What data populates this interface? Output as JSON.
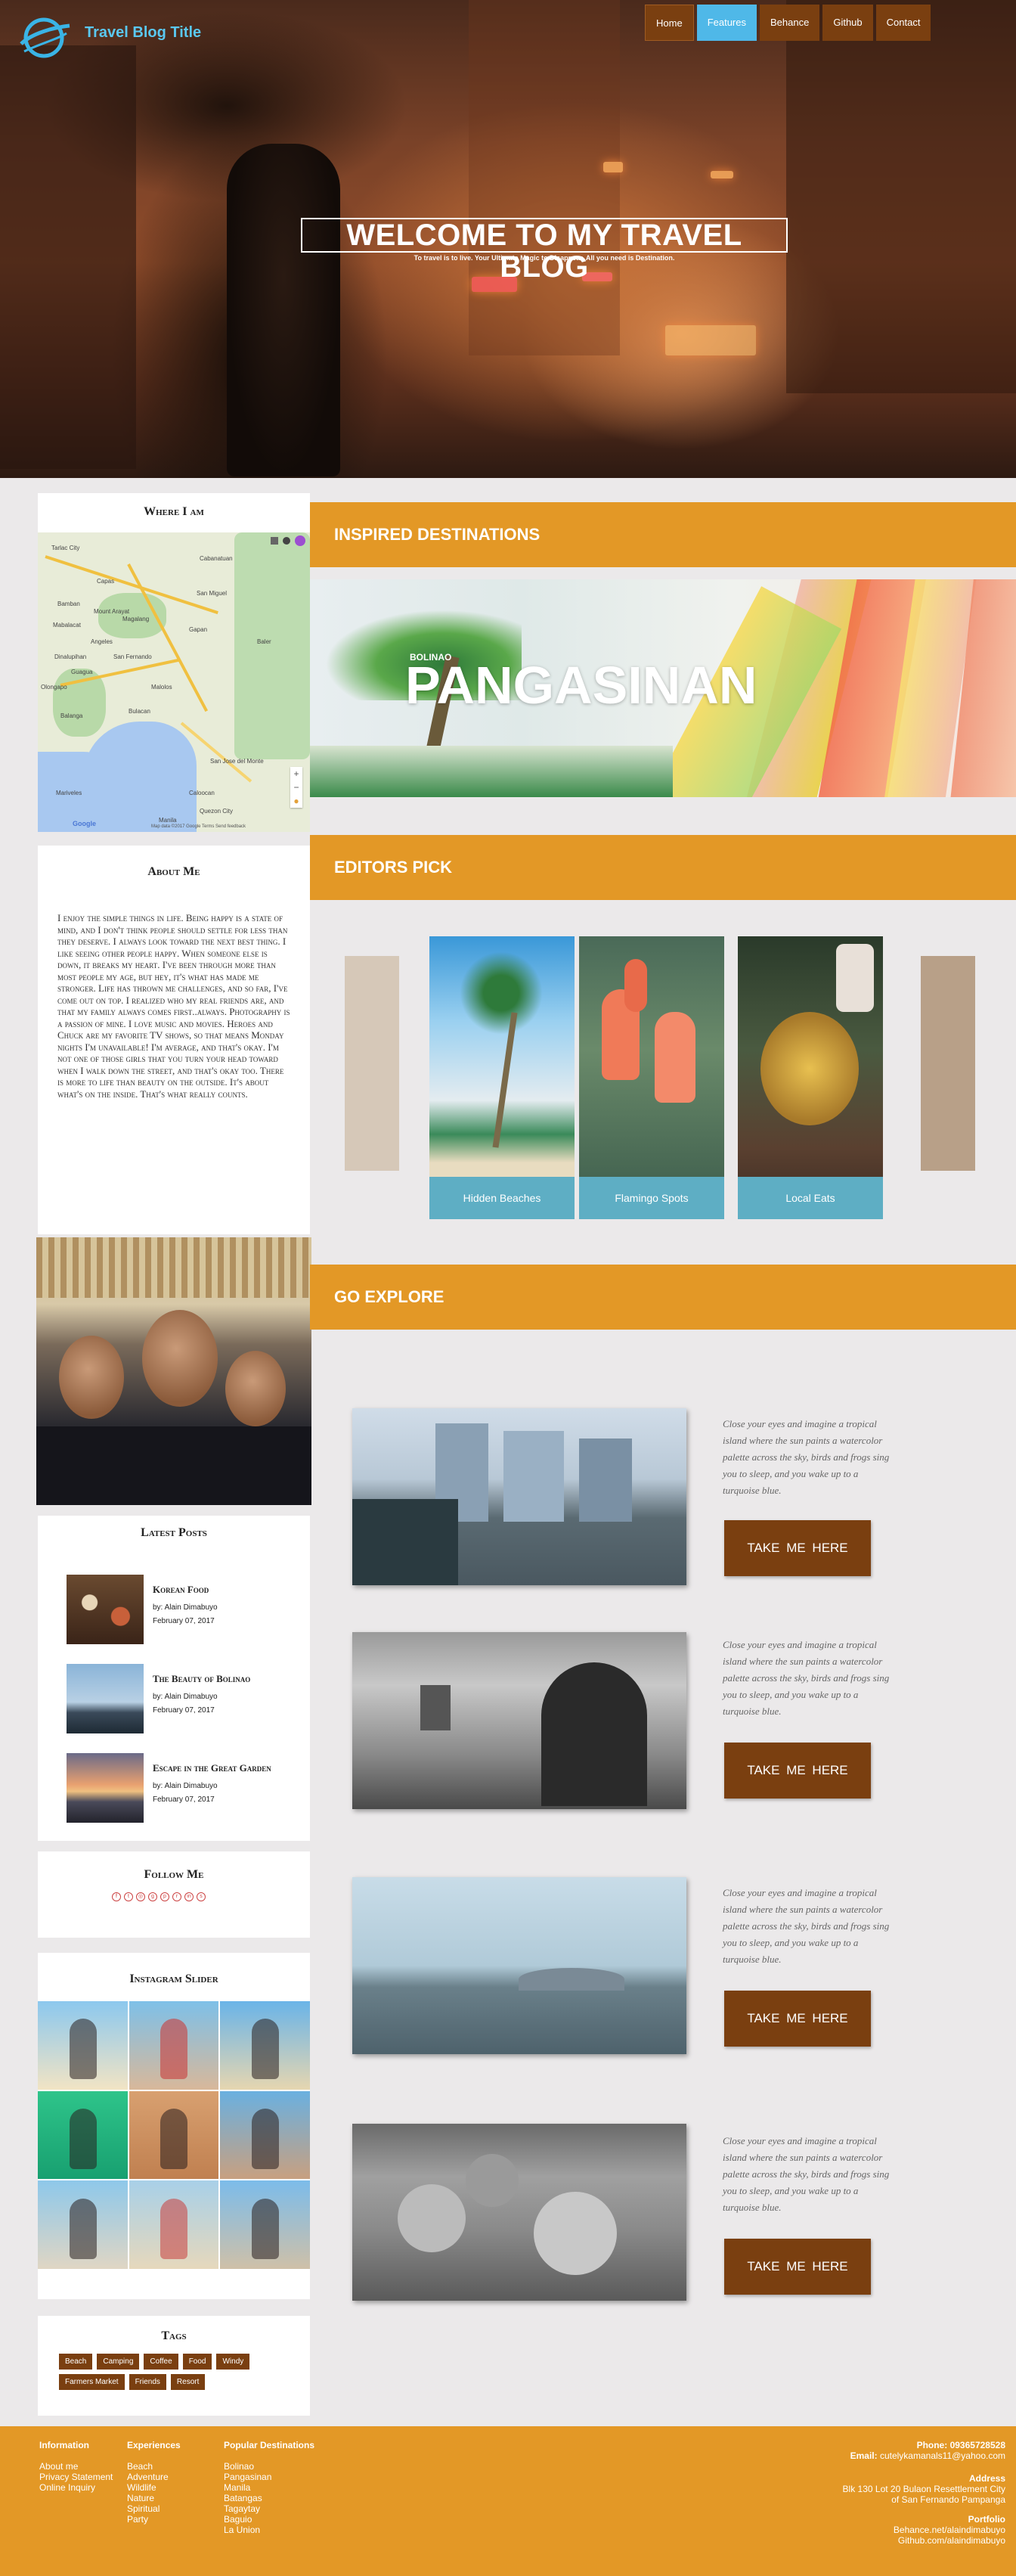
{
  "header": {
    "brand": "Travel Blog Title",
    "nav": [
      "Home",
      "Features",
      "Behance",
      "Github",
      "Contact"
    ],
    "active_nav": "Features"
  },
  "hero": {
    "title": "WELCOME TO MY TRAVEL BLOG",
    "subtitle": "To travel is to live. Your Ultimate Magic to Disappear. All you need is Destination."
  },
  "sidebar": {
    "where": {
      "title": "Where I am",
      "map_towns": [
        "Tarlac City",
        "Capas",
        "Bamban",
        "Magalang",
        "Mabalacat",
        "Angeles",
        "San Fernando",
        "Guagua",
        "Olongapo",
        "Dinalupihan",
        "Balanga",
        "Malolos",
        "Bulacan",
        "San Miguel",
        "Cabanatuan",
        "Gapan",
        "Mariveles",
        "Quezon City",
        "Manila",
        "San Jose del Monte",
        "Caloocan",
        "Mount Arayat",
        "Baler"
      ],
      "map_credit": "Map data ©2017 Google  Terms  Send feedback",
      "google_logo": "Google"
    },
    "about": {
      "title": "About Me",
      "text": "I enjoy the simple things in life. Being happy is a state of mind, and I don't think people should settle for less than they deserve. I always look toward the next best thing. I like seeing other people happy. When someone else is down, it breaks my heart. I've been through more than most people my age, but hey, it's what has made me stronger. Life has thrown me challenges, and so far, I've come out on top. I realized who my real friends are, and that my family always comes first..always. Photography is a passion of mine. I love music and movies. Heroes and Chuck are my favorite TV shows, so that means Monday nights I'm unavailable! I'm average, and that's okay. I'm not one of those girls that you turn your head toward when I walk down the street, and that's okay too. There is more to life than beauty on the outside. It's about what's on the inside. That's what really counts."
    },
    "latest": {
      "title": "Latest Posts",
      "posts": [
        {
          "title": "Korean Food",
          "author": "by: Alain Dimabuyo",
          "date": "February 07, 2017"
        },
        {
          "title": "The Beauty of Bolinao",
          "author": "by: Alain Dimabuyo",
          "date": "February 07, 2017"
        },
        {
          "title": "Escape in the Great Garden",
          "author": "by: Alain Dimabuyo",
          "date": "February 07, 2017"
        }
      ]
    },
    "follow": {
      "title": "Follow Me",
      "icons": [
        "facebook-icon",
        "twitter-icon",
        "instagram-icon",
        "google-plus-icon",
        "pinterest-icon",
        "rss-icon",
        "linkedin-icon",
        "skype-icon"
      ]
    },
    "instagram": {
      "title": "Instagram Slider"
    },
    "tags": {
      "title": "Tags",
      "items": [
        "Beach",
        "Camping",
        "Coffee",
        "Food",
        "Windy",
        "Farmers Market",
        "Friends",
        "Resort"
      ]
    }
  },
  "inspired": {
    "title": "INSPIRED DESTINATIONS",
    "place_small": "BOLINAO",
    "place_big": "PANGASINAN"
  },
  "editors": {
    "title": "EDITORS PICK",
    "cards": [
      "Hidden Beaches",
      "Flamingo Spots",
      "Local Eats"
    ]
  },
  "explore": {
    "title": "GO EXPLORE",
    "text": "Close your eyes and imagine a tropical island where the sun paints a watercolor palette across the sky, birds and frogs sing you to sleep, and you wake up to a turquoise blue.",
    "button": "TAKE ME HERE"
  },
  "footer": {
    "information": {
      "title": "Information",
      "items": [
        "About me",
        "Privacy Statement",
        "Online Inquiry"
      ]
    },
    "experiences": {
      "title": "Experiences",
      "items": [
        "Beach",
        "Adventure",
        "Wildlife",
        "Nature",
        "Spiritual",
        "Party"
      ]
    },
    "destinations": {
      "title": "Popular Destinations",
      "items": [
        "Bolinao",
        "Pangasinan",
        "Manila",
        "Batangas",
        "Tagaytay",
        "Baguio",
        "La Union"
      ]
    },
    "phone_label": "Phone:",
    "phone": "09365728528",
    "email_label": "Email:",
    "email": "cutelykamanals11@yahoo.com",
    "address_label": "Address",
    "address_1": "Blk 130 Lot 20 Bulaon Resettlement City",
    "address_2": "of San Fernando Pampanga",
    "portfolio_label": "Portfolio",
    "portfolio_1": "Behance.net/alaindimabuyo",
    "portfolio_2": "Github.com/alaindimabuyo"
  },
  "colors": {
    "accent": "#e39826",
    "button": "#7a3f10",
    "caption": "#5eaec4",
    "nav_active": "#4fb8e8",
    "brand": "#5ac8f0"
  }
}
